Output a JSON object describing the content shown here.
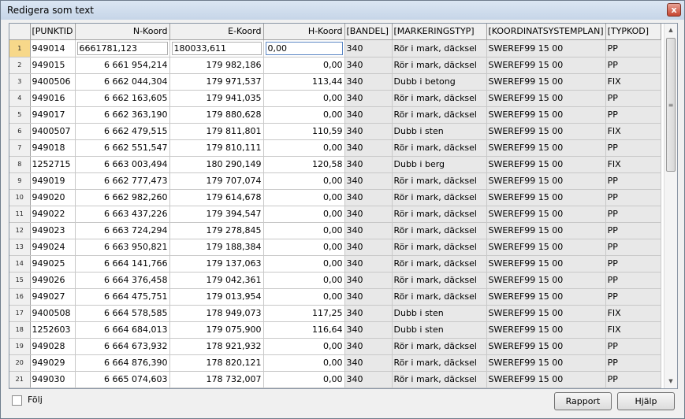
{
  "window": {
    "title": "Redigera som text",
    "close_label": "x"
  },
  "grid": {
    "columns": [
      "[PUNKTID",
      "N-Koord",
      "E-Koord",
      "H-Koord",
      "[BANDEL]",
      "[MARKERINGSTYP]",
      "[KOORDINATSYSTEMPLAN]",
      "[TYPKOD]"
    ],
    "rows": [
      [
        "1",
        "949014",
        "6661781,123",
        "180033,611",
        "0,00",
        "340",
        "Rör i mark, däcksel",
        "SWEREF99 15 00",
        "PP"
      ],
      [
        "2",
        "949015",
        "6 661 954,214",
        "179 982,186",
        "0,00",
        "340",
        "Rör i mark, däcksel",
        "SWEREF99 15 00",
        "PP"
      ],
      [
        "3",
        "9400506",
        "6 662 044,304",
        "179 971,537",
        "113,44",
        "340",
        "Dubb i betong",
        "SWEREF99 15 00",
        "FIX"
      ],
      [
        "4",
        "949016",
        "6 662 163,605",
        "179 941,035",
        "0,00",
        "340",
        "Rör i mark, däcksel",
        "SWEREF99 15 00",
        "PP"
      ],
      [
        "5",
        "949017",
        "6 662 363,190",
        "179 880,628",
        "0,00",
        "340",
        "Rör i mark, däcksel",
        "SWEREF99 15 00",
        "PP"
      ],
      [
        "6",
        "9400507",
        "6 662 479,515",
        "179 811,801",
        "110,59",
        "340",
        "Dubb i sten",
        "SWEREF99 15 00",
        "FIX"
      ],
      [
        "7",
        "949018",
        "6 662 551,547",
        "179 810,111",
        "0,00",
        "340",
        "Rör i mark, däcksel",
        "SWEREF99 15 00",
        "PP"
      ],
      [
        "8",
        "1252715",
        "6 663 003,494",
        "180 290,149",
        "120,58",
        "340",
        "Dubb i berg",
        "SWEREF99 15 00",
        "FIX"
      ],
      [
        "9",
        "949019",
        "6 662 777,473",
        "179 707,074",
        "0,00",
        "340",
        "Rör i mark, däcksel",
        "SWEREF99 15 00",
        "PP"
      ],
      [
        "10",
        "949020",
        "6 662 982,260",
        "179 614,678",
        "0,00",
        "340",
        "Rör i mark, däcksel",
        "SWEREF99 15 00",
        "PP"
      ],
      [
        "11",
        "949022",
        "6 663 437,226",
        "179 394,547",
        "0,00",
        "340",
        "Rör i mark, däcksel",
        "SWEREF99 15 00",
        "PP"
      ],
      [
        "12",
        "949023",
        "6 663 724,294",
        "179 278,845",
        "0,00",
        "340",
        "Rör i mark, däcksel",
        "SWEREF99 15 00",
        "PP"
      ],
      [
        "13",
        "949024",
        "6 663 950,821",
        "179 188,384",
        "0,00",
        "340",
        "Rör i mark, däcksel",
        "SWEREF99 15 00",
        "PP"
      ],
      [
        "14",
        "949025",
        "6 664 141,766",
        "179 137,063",
        "0,00",
        "340",
        "Rör i mark, däcksel",
        "SWEREF99 15 00",
        "PP"
      ],
      [
        "15",
        "949026",
        "6 664 376,458",
        "179 042,361",
        "0,00",
        "340",
        "Rör i mark, däcksel",
        "SWEREF99 15 00",
        "PP"
      ],
      [
        "16",
        "949027",
        "6 664 475,751",
        "179 013,954",
        "0,00",
        "340",
        "Rör i mark, däcksel",
        "SWEREF99 15 00",
        "PP"
      ],
      [
        "17",
        "9400508",
        "6 664 578,585",
        "178 949,073",
        "117,25",
        "340",
        "Dubb i sten",
        "SWEREF99 15 00",
        "FIX"
      ],
      [
        "18",
        "1252603",
        "6 664 684,013",
        "179 075,900",
        "116,64",
        "340",
        "Dubb i sten",
        "SWEREF99 15 00",
        "FIX"
      ],
      [
        "19",
        "949028",
        "6 664 673,932",
        "178 921,932",
        "0,00",
        "340",
        "Rör i mark, däcksel",
        "SWEREF99 15 00",
        "PP"
      ],
      [
        "20",
        "949029",
        "6 664 876,390",
        "178 820,121",
        "0,00",
        "340",
        "Rör i mark, däcksel",
        "SWEREF99 15 00",
        "PP"
      ],
      [
        "21",
        "949030",
        "6 665 074,603",
        "178 732,007",
        "0,00",
        "340",
        "Rör i mark, däcksel",
        "SWEREF99 15 00",
        "PP"
      ]
    ]
  },
  "scrollbar": {
    "up_label": "▲",
    "down_label": "▼",
    "thumb_grip": "≡"
  },
  "footer": {
    "follow_label": "Följ",
    "follow_checked": false,
    "report_button": "Rapport",
    "help_button": "Hjälp"
  }
}
